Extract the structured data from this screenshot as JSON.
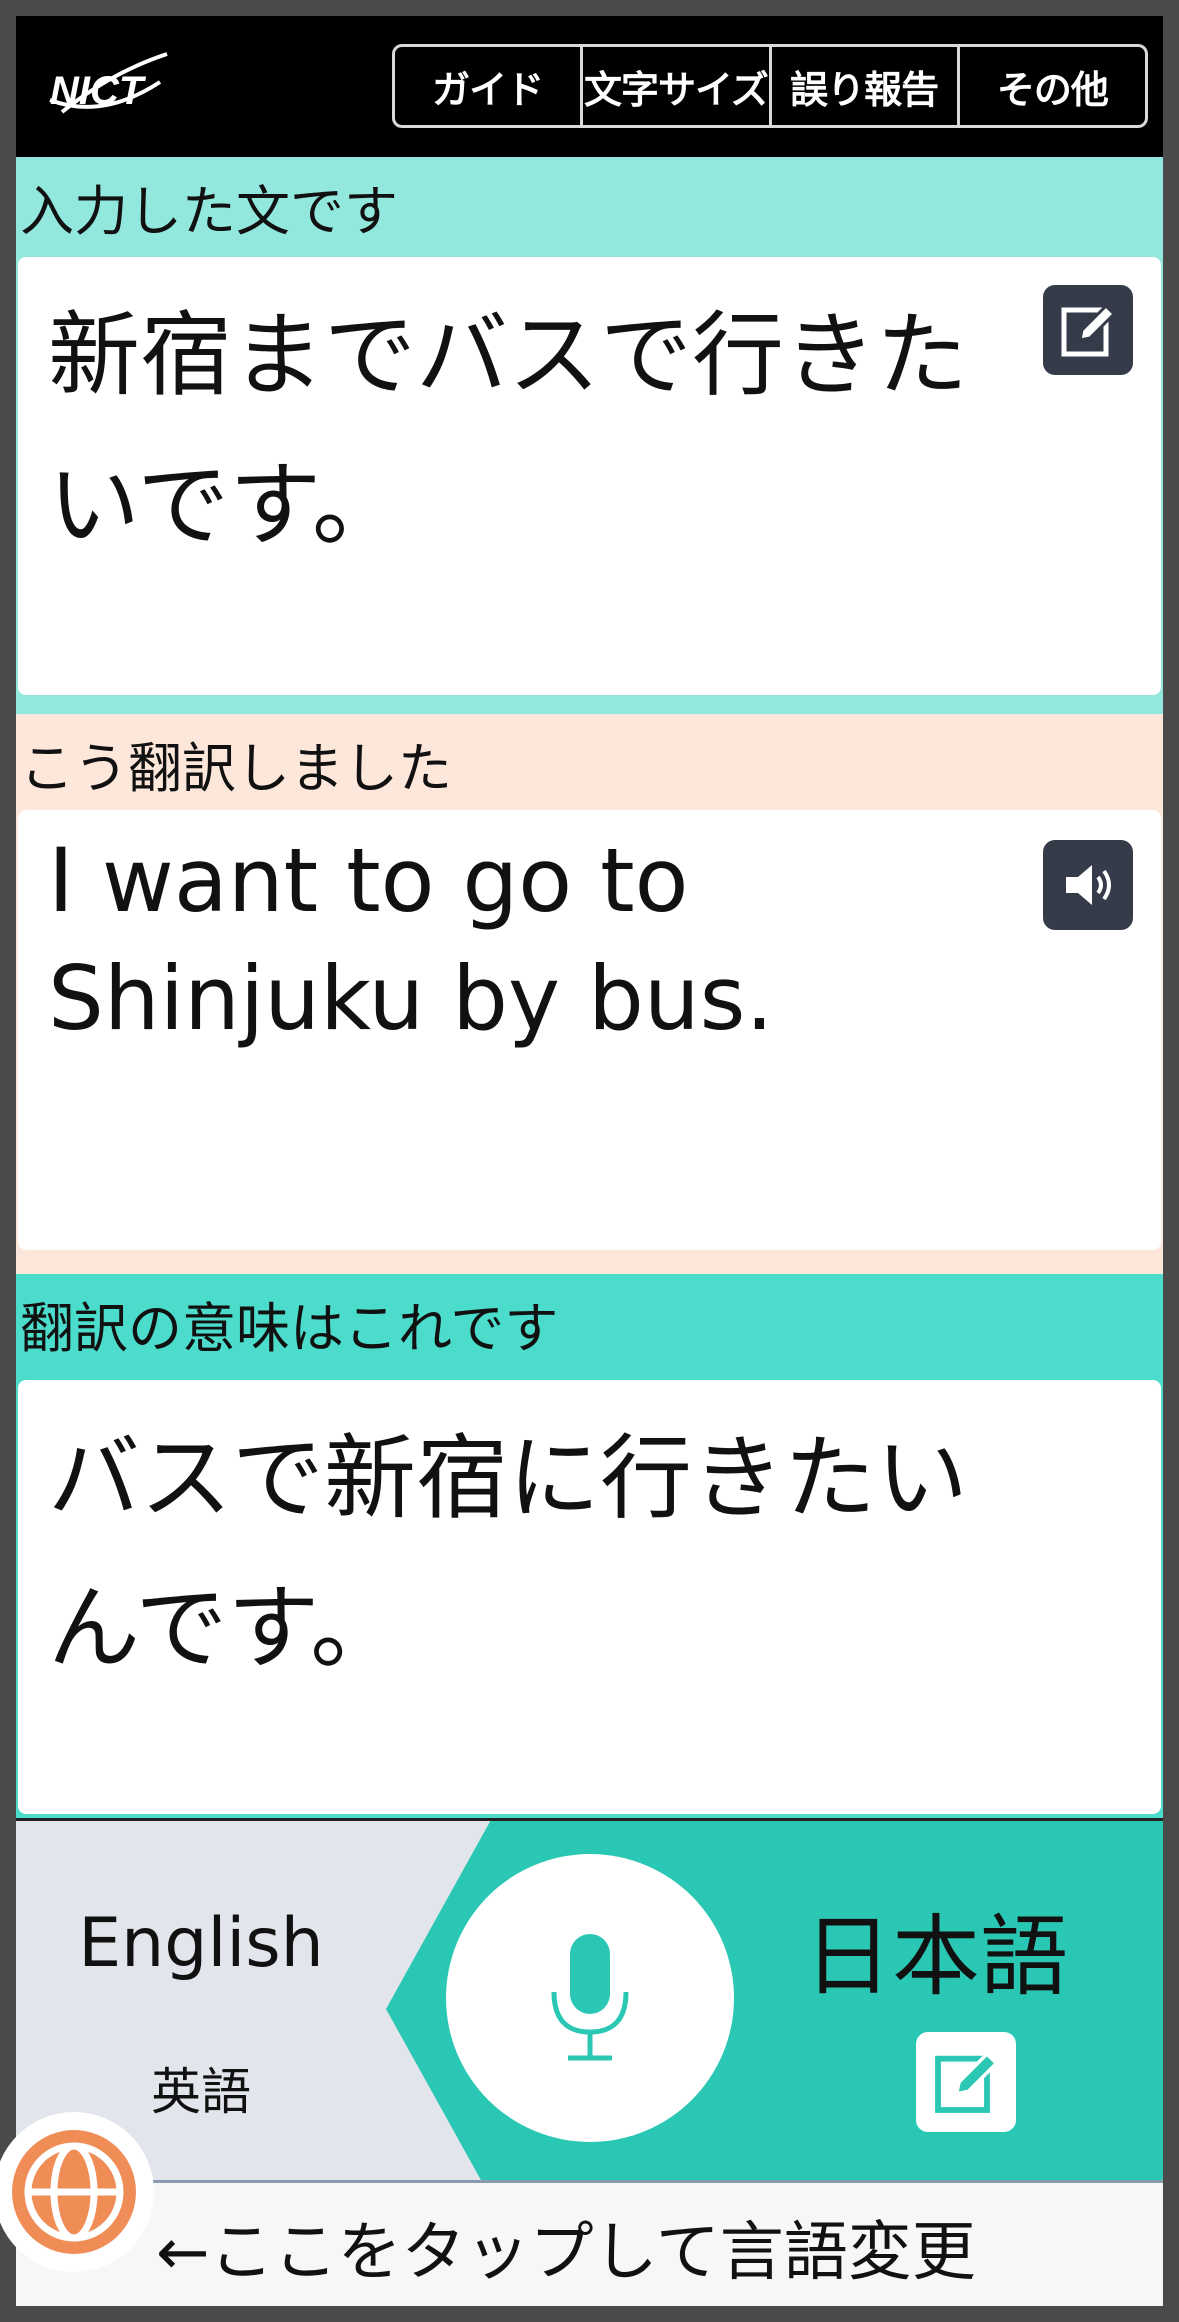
{
  "header": {
    "logo_text": "NICT",
    "menu": [
      {
        "label": "ガイド"
      },
      {
        "label": "文字サイズ"
      },
      {
        "label": "誤り報告"
      },
      {
        "label": "その他"
      }
    ]
  },
  "input_section": {
    "label": "入力した文です",
    "text": "新宿までバスで行きたいです。",
    "icon": "edit-icon"
  },
  "translation_section": {
    "label": "こう翻訳しました",
    "text": "I want to go to Shinjuku by bus.",
    "icon": "speaker-icon"
  },
  "backtranslation_section": {
    "label": "翻訳の意味はこれです",
    "text": "バスで新宿に行きたいんです。"
  },
  "language_bar": {
    "left_language": "English",
    "left_language_sub": "英語",
    "right_language": "日本語",
    "mic_icon": "microphone-icon",
    "edit_icon": "edit-icon"
  },
  "footer": {
    "hint": "←ここをタップして言語変更",
    "globe_icon": "globe-icon"
  },
  "colors": {
    "input_bg": "#93e8de",
    "translation_bg": "#fde6da",
    "backtranslation_bg": "#4bdccb",
    "teal": "#2ac8b4",
    "globe": "#f08d57",
    "icon_dark": "#353b48"
  }
}
